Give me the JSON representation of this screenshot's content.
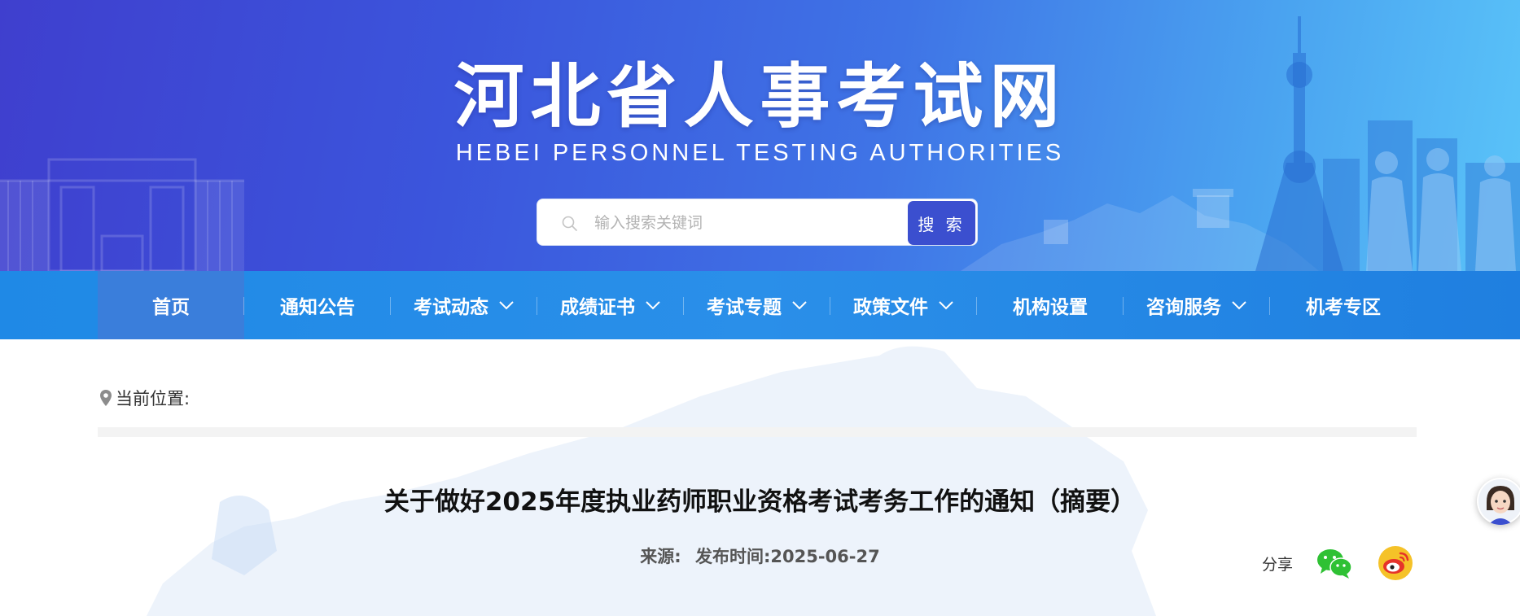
{
  "header": {
    "title": "河北省人事考试网",
    "subtitle": "HEBEI PERSONNEL TESTING AUTHORITIES"
  },
  "search": {
    "placeholder": "输入搜索关键词",
    "value": "",
    "button_label": "搜 索"
  },
  "nav": {
    "items": [
      {
        "label": "首页",
        "dropdown": false,
        "active": true
      },
      {
        "label": "通知公告",
        "dropdown": false,
        "active": false
      },
      {
        "label": "考试动态",
        "dropdown": true,
        "active": false
      },
      {
        "label": "成绩证书",
        "dropdown": true,
        "active": false
      },
      {
        "label": "考试专题",
        "dropdown": true,
        "active": false
      },
      {
        "label": "政策文件",
        "dropdown": true,
        "active": false
      },
      {
        "label": "机构设置",
        "dropdown": false,
        "active": false
      },
      {
        "label": "咨询服务",
        "dropdown": true,
        "active": false
      },
      {
        "label": "机考专区",
        "dropdown": false,
        "active": false
      }
    ]
  },
  "breadcrumb": {
    "label": "当前位置:"
  },
  "article": {
    "title": "关于做好2025年度执业药师职业资格考试考务工作的通知（摘要）",
    "source_label": "来源:",
    "date_label": "发布时间:2025-06-27"
  },
  "share": {
    "label": "分享",
    "icons": [
      "wechat-icon",
      "weibo-icon"
    ]
  },
  "colors": {
    "banner_start": "#3f3fce",
    "banner_end": "#5ac4f9",
    "nav_bg": "#2a8fe9",
    "nav_active": "#3a7edb",
    "search_button": "#3b4fcf"
  }
}
